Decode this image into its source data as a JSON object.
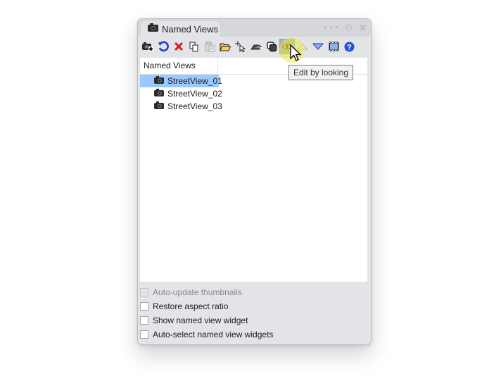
{
  "panel": {
    "tab_title": "Named Views",
    "tab_icon": "camera-icon",
    "titlebar_icons": [
      "more-dots-icon",
      "gear-icon",
      "close-icon"
    ]
  },
  "toolbar": {
    "buttons": [
      {
        "name": "save-view-button",
        "icon": "camera-add-icon"
      },
      {
        "name": "restore-view-button",
        "icon": "undo-arc-icon"
      },
      {
        "name": "delete-button",
        "icon": "red-x-icon"
      },
      {
        "name": "copy-button",
        "icon": "copy-icon"
      },
      {
        "name": "paste-button",
        "icon": "paste-icon",
        "disabled": true
      },
      {
        "name": "open-button",
        "icon": "folder-icon"
      },
      {
        "name": "select-button",
        "icon": "select-cursor-icon"
      },
      {
        "name": "import-button",
        "icon": "hand-icon"
      },
      {
        "name": "duplicate-button",
        "icon": "stack-icon"
      },
      {
        "name": "edit-by-looking-button",
        "icon": "eye-icon",
        "hover": true
      },
      {
        "name": "move-up-button",
        "icon": "triangle-up-icon",
        "disabled": true
      },
      {
        "name": "move-down-button",
        "icon": "triangle-down-icon"
      },
      {
        "name": "viewport-button",
        "icon": "film-frame-icon"
      },
      {
        "name": "help-button",
        "icon": "help-icon"
      }
    ]
  },
  "list": {
    "header": "Named Views",
    "items": [
      {
        "label": "StreetView_01",
        "selected": true
      },
      {
        "label": "StreetView_02",
        "selected": false
      },
      {
        "label": "StreetView_03",
        "selected": false
      }
    ]
  },
  "options": [
    {
      "label": "Auto-update thumbnails",
      "checked": false,
      "disabled": true
    },
    {
      "label": "Restore aspect ratio",
      "checked": false,
      "disabled": false
    },
    {
      "label": "Show named view widget",
      "checked": false,
      "disabled": false
    },
    {
      "label": "Auto-select named view widgets",
      "checked": false,
      "disabled": false
    }
  ],
  "tooltip": {
    "text": "Edit by looking"
  },
  "colors": {
    "selection": "#99c9ff",
    "panel_bg": "#e3e4e8",
    "delete_red": "#e0191e",
    "accent_blue": "#1f3fc0"
  }
}
